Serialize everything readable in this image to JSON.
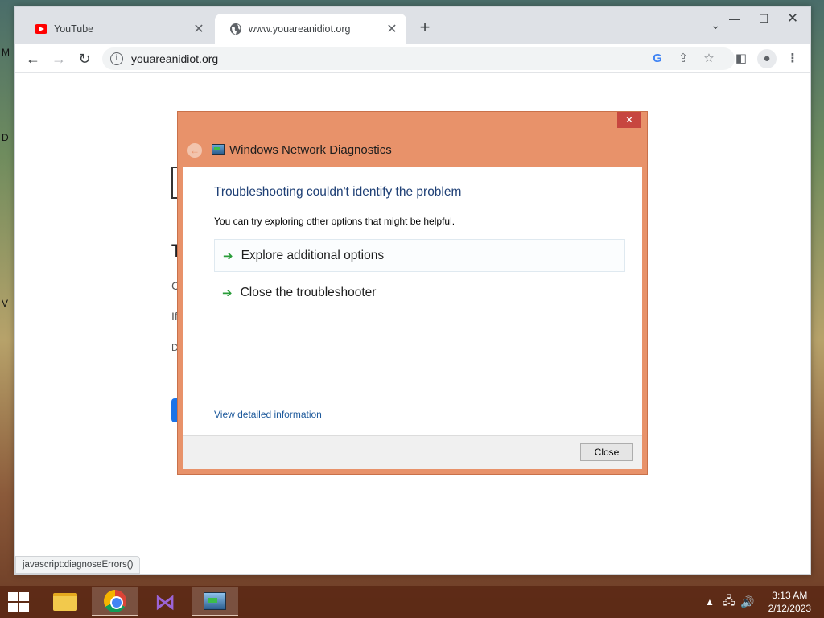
{
  "desktop": {
    "edge_letters": [
      "M",
      "D",
      "V"
    ]
  },
  "browser": {
    "tabs": [
      {
        "title": "YouTube",
        "icon": "youtube-icon",
        "active": false
      },
      {
        "title": "www.youareanidiot.org",
        "icon": "globe-icon",
        "active": true
      }
    ],
    "address": "youareanidiot.org",
    "status_tip": "javascript:diagnoseErrors()",
    "page_fragments": [
      "T",
      "C",
      "If",
      "D"
    ]
  },
  "dialog": {
    "title": "Windows Network Diagnostics",
    "heading": "Troubleshooting couldn't identify the problem",
    "subtext": "You can try exploring other options that might be helpful.",
    "options": [
      {
        "label": "Explore additional options",
        "highlighted": true
      },
      {
        "label": "Close the troubleshooter",
        "highlighted": false
      }
    ],
    "link": "View detailed information",
    "close_button": "Close",
    "accent_color": "#e8926a"
  },
  "taskbar": {
    "apps": [
      "file-explorer",
      "google-chrome",
      "visual-studio",
      "windows-network-diagnostics"
    ],
    "time": "3:13 AM",
    "date": "2/12/2023"
  }
}
